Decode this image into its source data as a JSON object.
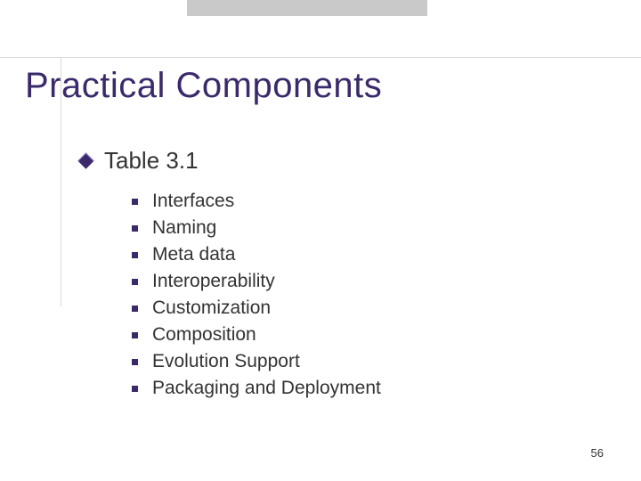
{
  "title": "Practical Components",
  "list": {
    "heading": "Table 3.1",
    "items": [
      "Interfaces",
      "Naming",
      "Meta data",
      "Interoperability",
      "Customization",
      "Composition",
      "Evolution Support",
      "Packaging and Deployment"
    ]
  },
  "page_number": "56"
}
